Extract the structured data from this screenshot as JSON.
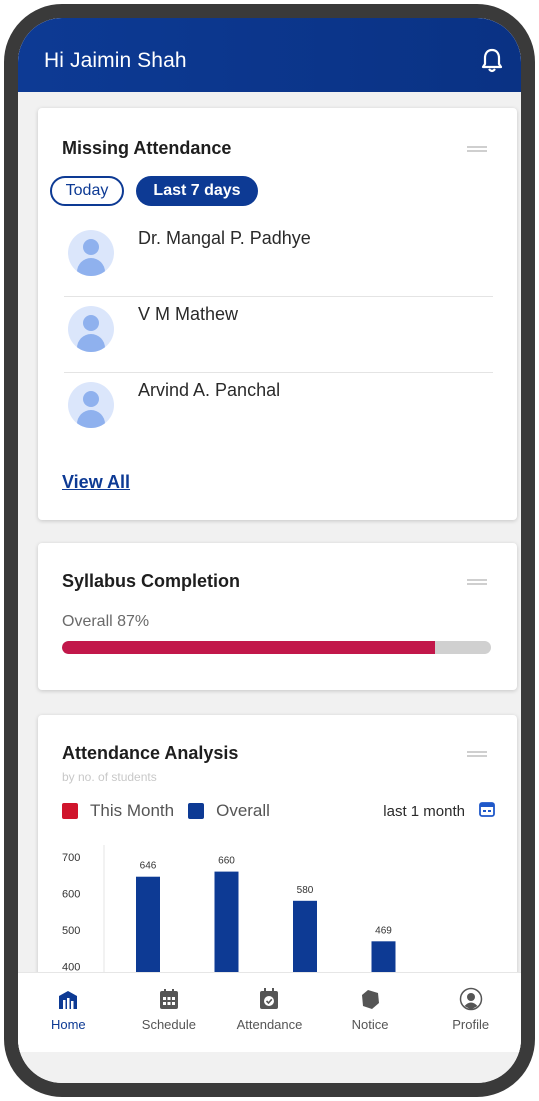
{
  "header": {
    "greeting": "Hi Jaimin Shah",
    "icon": "bell-icon"
  },
  "missing_attendance": {
    "title": "Missing Attendance",
    "filters": [
      "Today",
      "Last 7 days"
    ],
    "active_filter": "Last 7 days",
    "people": [
      {
        "name": "Dr. Mangal P. Padhye"
      },
      {
        "name": "V M Mathew"
      },
      {
        "name": "Arvind A. Panchal"
      }
    ],
    "view_all": "View All"
  },
  "syllabus": {
    "title": "Syllabus Completion",
    "overall_label": "Overall 87%",
    "progress": 0.87
  },
  "attendance_analysis": {
    "title": "Attendance Analysis",
    "subtitle": "by no. of students",
    "legend": [
      {
        "label": "This Month",
        "color": "#d0142c"
      },
      {
        "label": "Overall",
        "color": "#0d3a94"
      }
    ],
    "range_label": "last 1 month",
    "range_icon": "calendar-icon"
  },
  "chart_data": {
    "type": "bar",
    "categories": [
      "",
      "",
      "",
      ""
    ],
    "series": [
      {
        "values": [
          646,
          660,
          580,
          469
        ]
      }
    ],
    "data_labels": [
      "646",
      "660",
      "580",
      "469"
    ],
    "yticks": [
      "700",
      "600",
      "500",
      "400"
    ],
    "ylim": [
      370,
      700
    ],
    "bar_color": "#0d3a94"
  },
  "nav": [
    {
      "label": "Home",
      "icon": "home-icon",
      "active": true
    },
    {
      "label": "Schedule",
      "icon": "schedule-icon",
      "active": false
    },
    {
      "label": "Attendance",
      "icon": "attendance-icon",
      "active": false
    },
    {
      "label": "Notice",
      "icon": "notice-icon",
      "active": false
    },
    {
      "label": "Profile",
      "icon": "profile-icon",
      "active": false
    }
  ]
}
